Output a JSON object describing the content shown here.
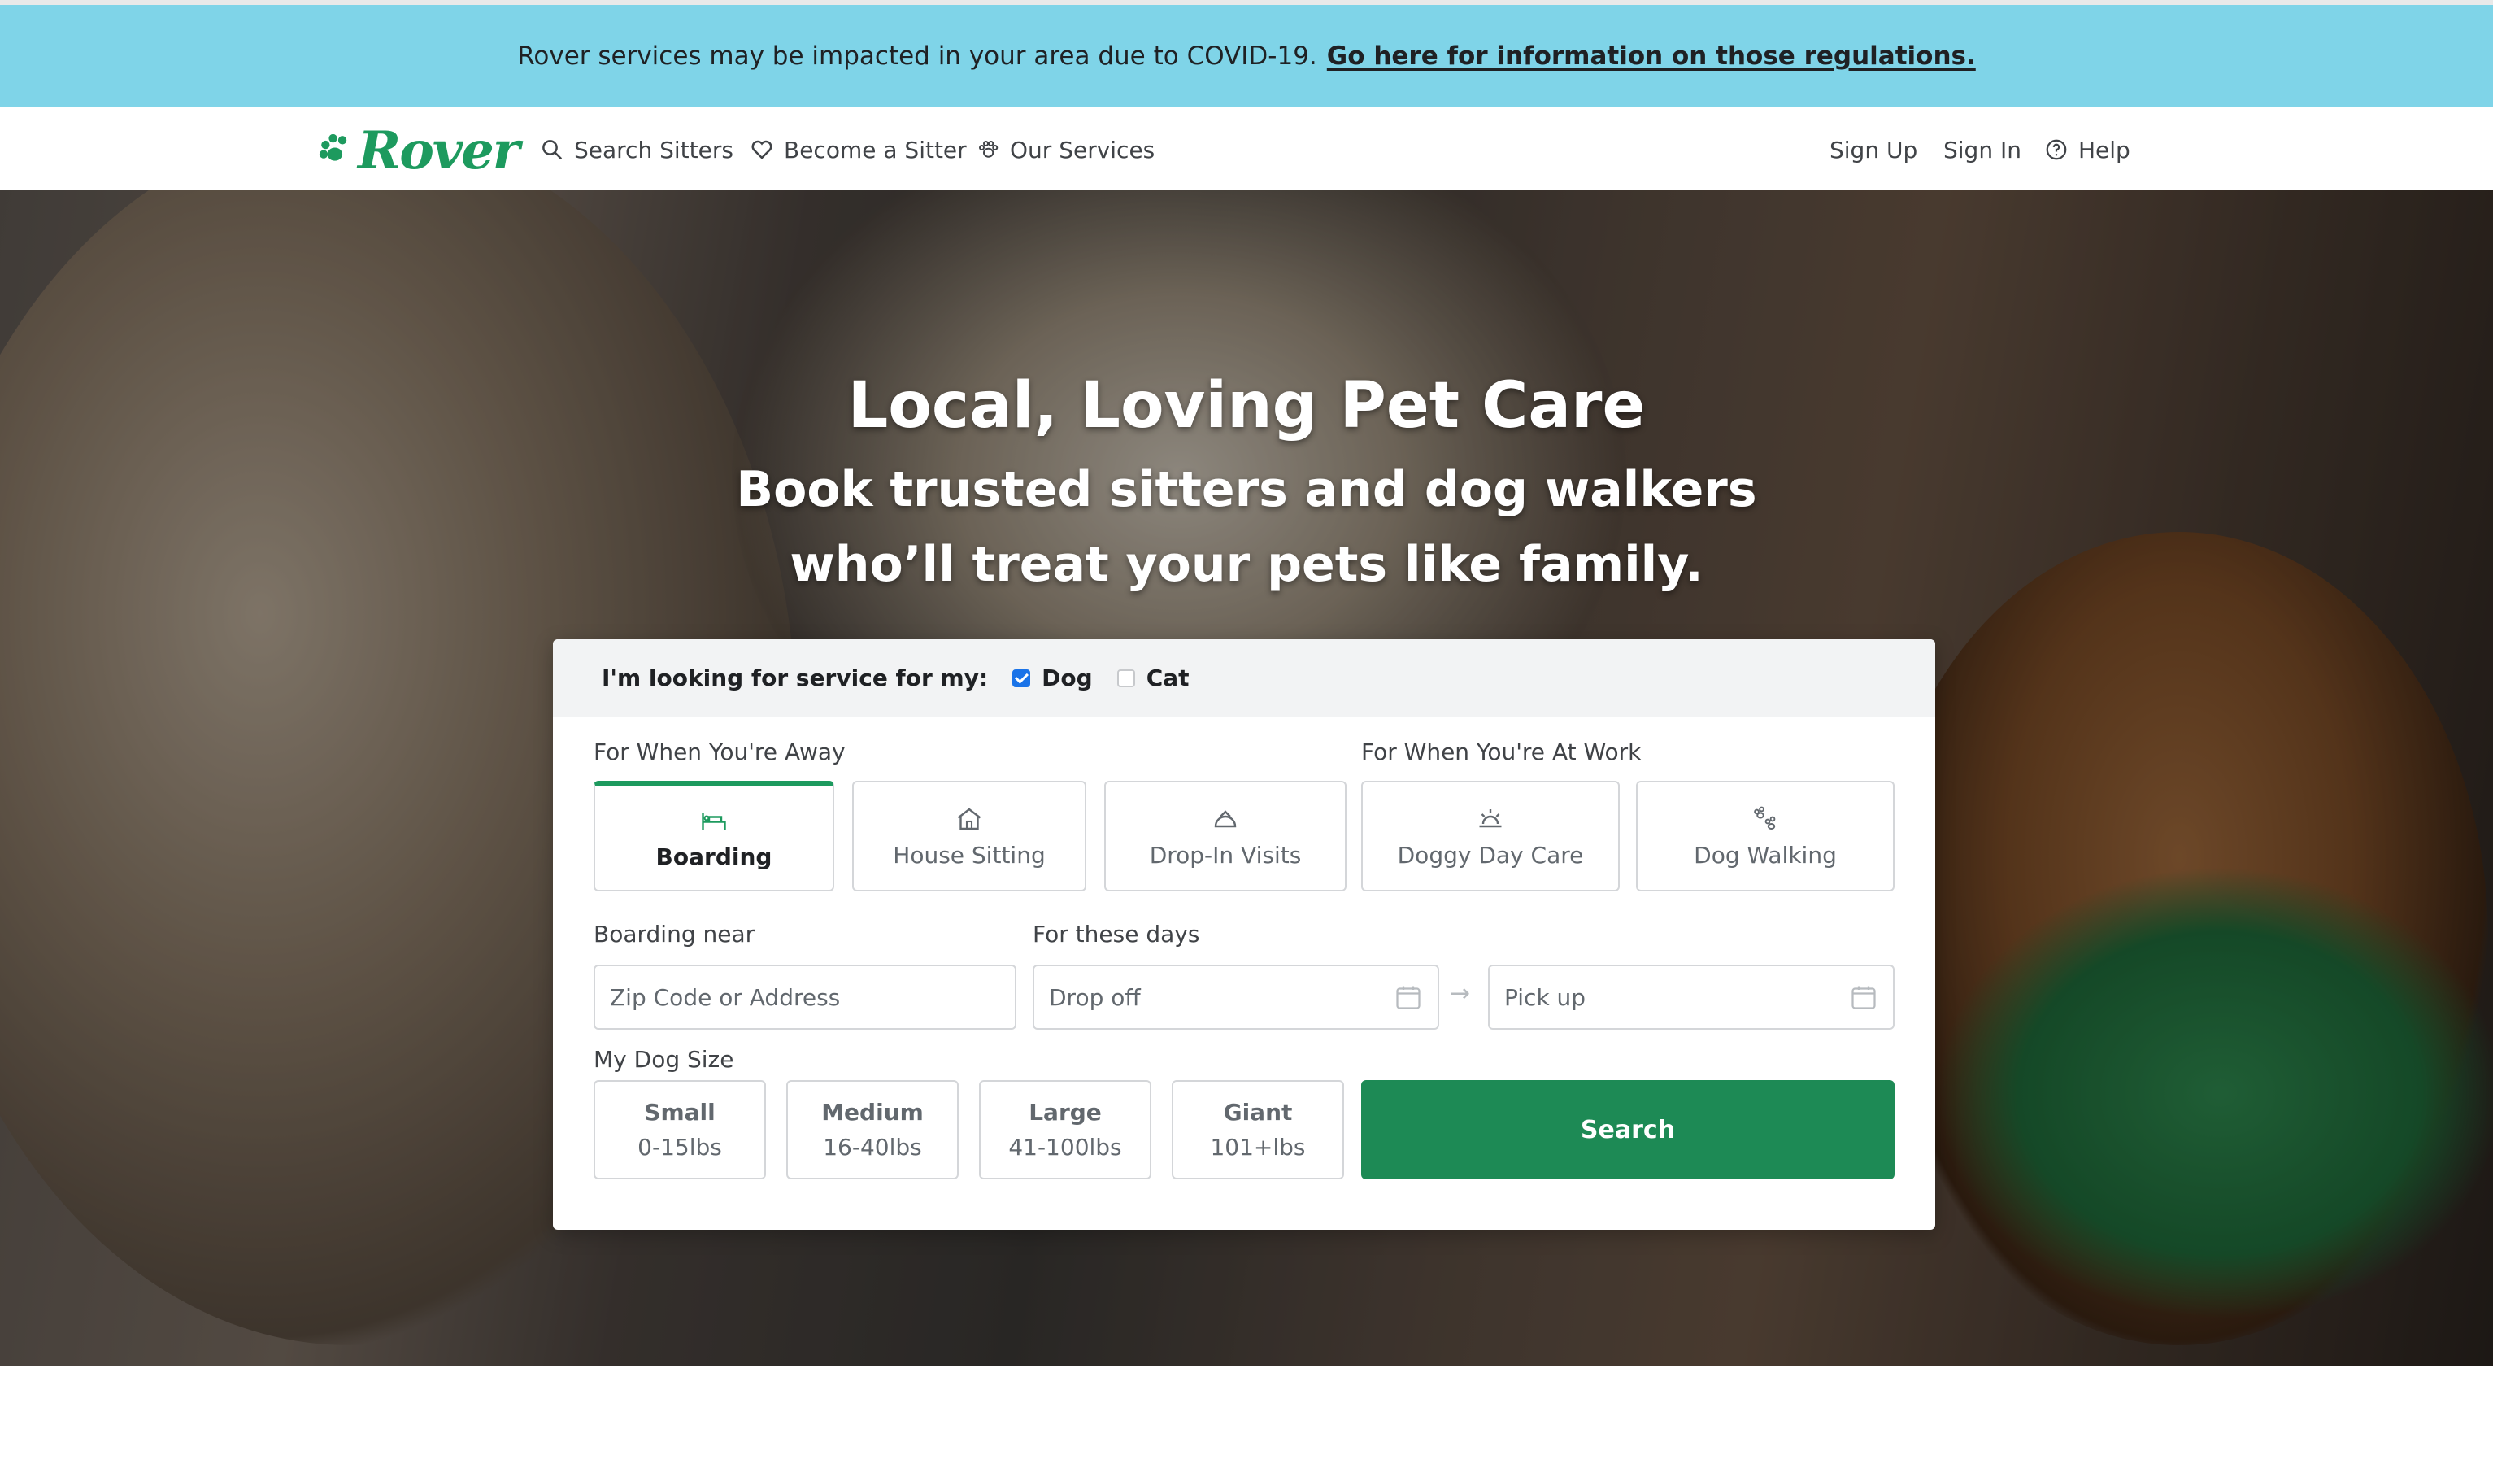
{
  "banner": {
    "text": "Rover services may be impacted in your area due to COVID-19.",
    "link": "Go here for information on those regulations."
  },
  "header": {
    "logo_text": "Rover",
    "nav": {
      "search_sitters": "Search Sitters",
      "become_sitter": "Become a Sitter",
      "our_services": "Our Services"
    },
    "right": {
      "sign_up": "Sign Up",
      "sign_in": "Sign In",
      "help": "Help"
    }
  },
  "hero": {
    "title": "Local, Loving Pet Care",
    "subtitle_line1": "Book trusted sitters and dog walkers",
    "subtitle_line2": "who’ll treat your pets like family."
  },
  "search": {
    "pet_question": "I'm looking for service for my:",
    "pets": {
      "dog": {
        "label": "Dog",
        "checked": true
      },
      "cat": {
        "label": "Cat",
        "checked": false
      }
    },
    "away_label": "For When You're Away",
    "work_label": "For When You're At Work",
    "services": {
      "boarding": "Boarding",
      "house_sitting": "House Sitting",
      "drop_in": "Drop-In Visits",
      "day_care": "Doggy Day Care",
      "walking": "Dog Walking"
    },
    "active_service": "Boarding",
    "near_label": "Boarding near",
    "address_placeholder": "Zip Code or Address",
    "days_label": "For these days",
    "drop_off_placeholder": "Drop off",
    "pick_up_placeholder": "Pick up",
    "size_label": "My Dog Size",
    "sizes": {
      "small": {
        "name": "Small",
        "weight": "0-15lbs"
      },
      "medium": {
        "name": "Medium",
        "weight": "16-40lbs"
      },
      "large": {
        "name": "Large",
        "weight": "41-100lbs"
      },
      "giant": {
        "name": "Giant",
        "weight": "101+lbs"
      }
    },
    "search_button": "Search"
  },
  "colors": {
    "banner": "#7fd4e8",
    "brand_green": "#1d9a5e",
    "search_button": "#1d8a55"
  }
}
